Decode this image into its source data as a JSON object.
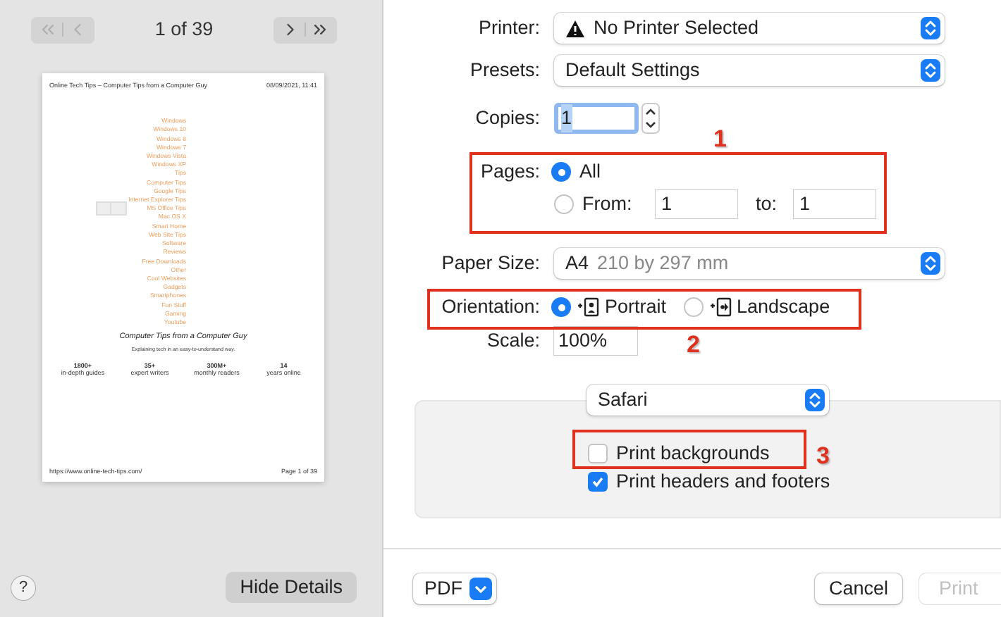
{
  "preview": {
    "nav": [
      {
        "kind": "back",
        "disabled": true
      },
      {
        "kind": "forward",
        "disabled": false
      }
    ],
    "page_counter": "1 of 39",
    "page": {
      "header_left": "Online Tech Tips – Computer Tips from a Computer Guy",
      "header_right": "08/09/2021, 11:41",
      "links": [
        "Windows",
        "Windows 10",
        "Windows 8",
        "Windows 7",
        "Windows Vista",
        "Windows XP",
        "Tips",
        "Computer Tips",
        "Google Tips",
        "Internet Explorer Tips",
        "MS Office Tips",
        "Mac OS X",
        "Smart Home",
        "Web Site Tips",
        "Software",
        "Reviews",
        "Free Downloads",
        "Other",
        "Cool Websites",
        "Gadgets",
        "Smartphones",
        "Fun Stuff",
        "Gaming",
        "Youtube"
      ],
      "title": "Computer Tips from a Computer Guy",
      "subtitle": "Explaining tech in an easy-to-understand way.",
      "stats": [
        {
          "number": "1800+",
          "label": "in-depth guides"
        },
        {
          "number": "35+",
          "label": "expert writers"
        },
        {
          "number": "300M+",
          "label": "monthly readers"
        },
        {
          "number": "14",
          "label": "years online"
        }
      ],
      "footer_left": "https://www.online-tech-tips.com/",
      "footer_right": "Page 1 of 39"
    },
    "help": "?",
    "hide_details": "Hide Details"
  },
  "form": {
    "printer": {
      "label": "Printer:",
      "value": "No Printer Selected"
    },
    "presets": {
      "label": "Presets:",
      "value": "Default Settings"
    },
    "copies": {
      "label": "Copies:",
      "value": "1"
    },
    "pages": {
      "label": "Pages:",
      "options": [
        {
          "label": "All",
          "selected": true
        },
        {
          "label": "From:",
          "selected": false
        }
      ],
      "from": "1",
      "to_label": "to:",
      "to": "1"
    },
    "paper_size": {
      "label": "Paper Size:",
      "value": "A4",
      "detail": "210 by 297 mm"
    },
    "orientation": {
      "label": "Orientation:",
      "options": [
        {
          "kind": "portrait",
          "label": "Portrait",
          "selected": true
        },
        {
          "kind": "landscape",
          "label": "Landscape",
          "selected": false
        }
      ]
    },
    "scale": {
      "label": "Scale:",
      "value": "100%"
    },
    "app_menu": "Safari",
    "checkboxes": [
      {
        "label": "Print backgrounds",
        "checked": false
      },
      {
        "label": "Print headers and footers",
        "checked": true
      }
    ]
  },
  "footer": {
    "pdf": "PDF",
    "cancel": "Cancel",
    "print": {
      "label": "Print",
      "disabled": true
    }
  },
  "annotations": [
    "1",
    "2",
    "3"
  ]
}
